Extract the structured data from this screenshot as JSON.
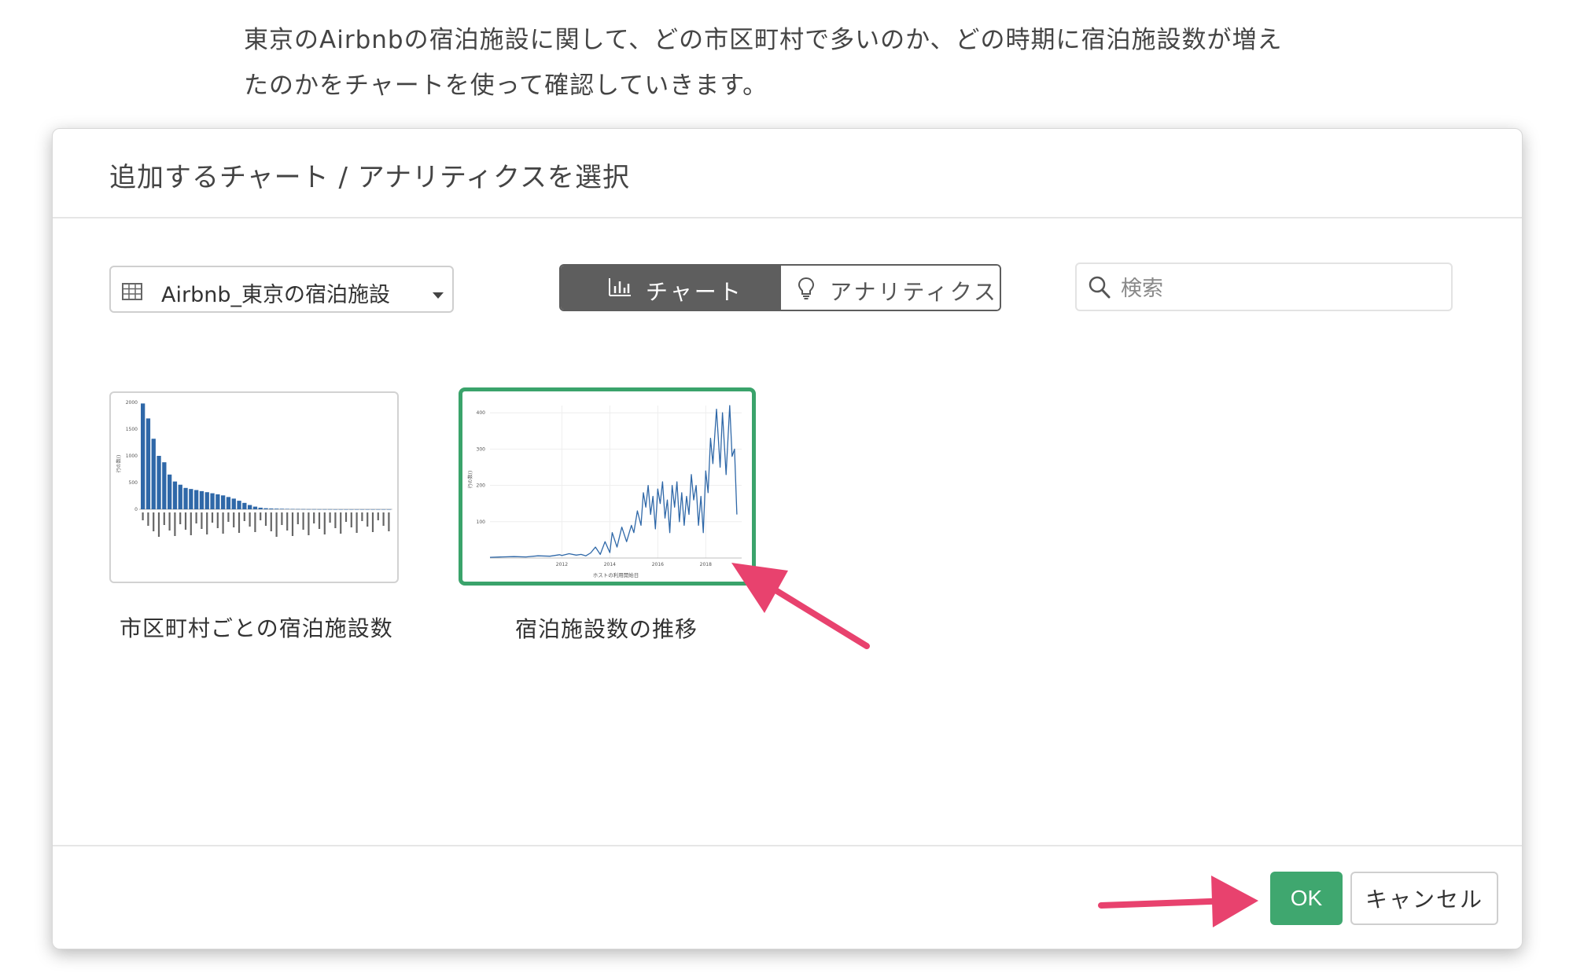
{
  "intro": {
    "line1": "東京のAirbnbの宿泊施設に関して、どの市区町村で多いのか、どの時期に宿泊施設数が増え",
    "line2": "たのかをチャートを使って確認していきます。"
  },
  "modal": {
    "title": "追加するチャート / アナリティクスを選択",
    "dataset": {
      "label": "Airbnb_東京の宿泊施設",
      "icon": "table-icon"
    },
    "toggle": {
      "chart_label": "チャート",
      "analytics_label": "アナリティクス",
      "selected": "chart"
    },
    "search": {
      "placeholder": "検索",
      "value": ""
    },
    "cards": [
      {
        "caption": "市区町村ごとの宿泊施設数",
        "thumbnail": {
          "type": "bar",
          "y_ticks": [
            "2000",
            "1500",
            "1000",
            "500",
            "0"
          ],
          "ylabel": "行の数()"
        }
      },
      {
        "caption": "宿泊施設数の推移",
        "selected": true,
        "thumbnail": {
          "type": "line",
          "y_ticks": [
            "400",
            "300",
            "200",
            "100"
          ],
          "x_ticks": [
            "2012",
            "2014",
            "2016",
            "2018"
          ],
          "xlabel": "ホストの利用開始日",
          "ylabel": "行の数()"
        }
      }
    ],
    "footer": {
      "ok_label": "OK",
      "cancel_label": "キャンセル"
    }
  },
  "colors": {
    "accent": "#3fa76f",
    "annotation_arrow": "#e8426e",
    "bar": "#2f68a8",
    "toggle_active": "#5e5e5e"
  },
  "chart_data": [
    {
      "type": "bar",
      "title": "",
      "ylabel": "行の数()",
      "ylim": [
        0,
        2000
      ],
      "values": [
        1980,
        1700,
        1320,
        1000,
        880,
        650,
        520,
        460,
        400,
        380,
        360,
        340,
        320,
        300,
        280,
        260,
        230,
        200,
        160,
        120,
        80,
        50,
        30,
        20,
        15,
        12,
        10,
        8,
        6,
        5,
        4,
        3,
        3,
        2,
        2,
        2,
        1,
        1,
        1,
        1,
        1,
        1,
        1,
        1,
        1,
        1,
        1
      ]
    },
    {
      "type": "line",
      "title": "",
      "xlabel": "ホストの利用開始日",
      "ylabel": "行の数()",
      "xlim": [
        2009,
        2019.5
      ],
      "ylim": [
        0,
        420
      ],
      "x_ticks": [
        2012,
        2014,
        2016,
        2018
      ],
      "series": [
        {
          "x": [
            2009.0,
            2009.5,
            2010.0,
            2010.5,
            2011.0,
            2011.5,
            2011.9,
            2012.0,
            2012.3,
            2012.6,
            2012.8,
            2013.0,
            2013.2,
            2013.4,
            2013.6,
            2013.8,
            2014.0,
            2014.1,
            2014.3,
            2014.5,
            2014.7,
            2014.9,
            2015.0,
            2015.15,
            2015.3,
            2015.4,
            2015.5,
            2015.6,
            2015.7,
            2015.8,
            2015.9,
            2016.0,
            2016.1,
            2016.2,
            2016.3,
            2016.4,
            2016.5,
            2016.6,
            2016.7,
            2016.8,
            2016.9,
            2017.0,
            2017.1,
            2017.2,
            2017.3,
            2017.4,
            2017.5,
            2017.6,
            2017.7,
            2017.8,
            2017.9,
            2018.0,
            2018.1,
            2018.2,
            2018.3,
            2018.45,
            2018.6,
            2018.7,
            2018.85,
            2019.0,
            2019.1,
            2019.2,
            2019.3
          ],
          "y": [
            2,
            3,
            4,
            3,
            6,
            5,
            9,
            7,
            12,
            8,
            10,
            6,
            14,
            30,
            10,
            45,
            15,
            70,
            30,
            85,
            45,
            90,
            70,
            130,
            90,
            180,
            140,
            200,
            120,
            170,
            80,
            190,
            150,
            210,
            110,
            160,
            70,
            200,
            140,
            210,
            100,
            180,
            90,
            170,
            120,
            230,
            160,
            200,
            90,
            170,
            70,
            240,
            180,
            330,
            260,
            410,
            250,
            400,
            230,
            420,
            280,
            300,
            120
          ]
        }
      ]
    }
  ]
}
